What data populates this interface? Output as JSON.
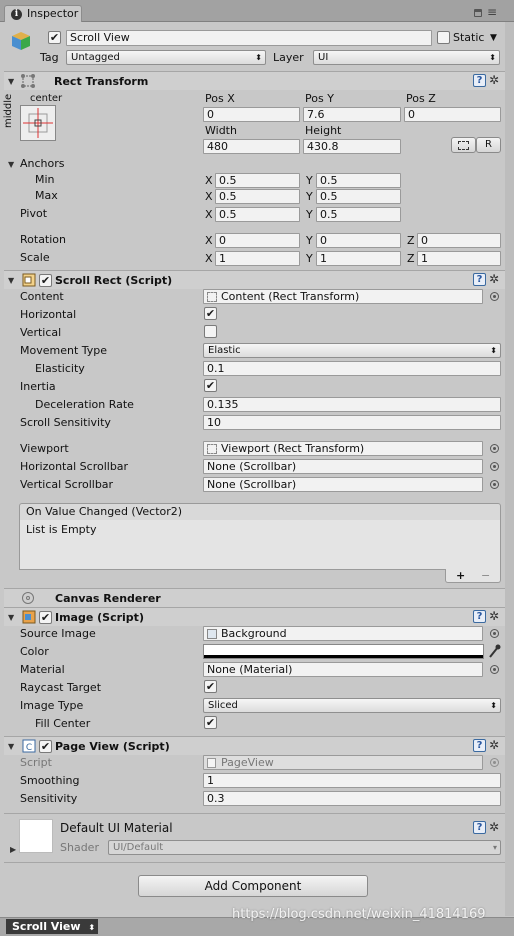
{
  "tab": {
    "title": "Inspector"
  },
  "object": {
    "name": "Scroll View",
    "static_label": "Static",
    "tag_label": "Tag",
    "tag_value": "Untagged",
    "layer_label": "Layer",
    "layer_value": "UI"
  },
  "rect_transform": {
    "title": "Rect Transform",
    "anchor_h": "center",
    "anchor_v": "middle",
    "pos_x_label": "Pos X",
    "pos_y_label": "Pos Y",
    "pos_z_label": "Pos Z",
    "pos_x": "0",
    "pos_y": "7.6",
    "pos_z": "0",
    "width_label": "Width",
    "height_label": "Height",
    "width": "480",
    "height": "430.8",
    "r_button": "R",
    "anchors_label": "Anchors",
    "min_label": "Min",
    "max_label": "Max",
    "pivot_label": "Pivot",
    "x": "X",
    "y": "Y",
    "z": "Z",
    "min_x": "0.5",
    "min_y": "0.5",
    "max_x": "0.5",
    "max_y": "0.5",
    "pivot_x": "0.5",
    "pivot_y": "0.5",
    "rotation_label": "Rotation",
    "rot_x": "0",
    "rot_y": "0",
    "rot_z": "0",
    "scale_label": "Scale",
    "scale_x": "1",
    "scale_y": "1",
    "scale_z": "1"
  },
  "scroll_rect": {
    "title": "Scroll Rect (Script)",
    "content_label": "Content",
    "content_value": "Content (Rect Transform)",
    "horizontal_label": "Horizontal",
    "vertical_label": "Vertical",
    "movement_label": "Movement Type",
    "movement_value": "Elastic",
    "elasticity_label": "Elasticity",
    "elasticity_value": "0.1",
    "inertia_label": "Inertia",
    "decel_label": "Deceleration Rate",
    "decel_value": "0.135",
    "sensitivity_label": "Scroll Sensitivity",
    "sensitivity_value": "10",
    "viewport_label": "Viewport",
    "viewport_value": "Viewport (Rect Transform)",
    "hscroll_label": "Horizontal Scrollbar",
    "hscroll_value": "None (Scrollbar)",
    "vscroll_label": "Vertical Scrollbar",
    "vscroll_value": "None (Scrollbar)",
    "event_title": "On Value Changed (Vector2)",
    "event_empty": "List is Empty",
    "plus": "+",
    "minus": "−"
  },
  "canvas_renderer": {
    "title": "Canvas Renderer"
  },
  "image": {
    "title": "Image (Script)",
    "source_label": "Source Image",
    "source_value": "Background",
    "color_label": "Color",
    "material_label": "Material",
    "material_value": "None (Material)",
    "raycast_label": "Raycast Target",
    "type_label": "Image Type",
    "type_value": "Sliced",
    "fill_label": "Fill Center"
  },
  "page_view": {
    "title": "Page View (Script)",
    "script_label": "Script",
    "script_value": "PageView",
    "smoothing_label": "Smoothing",
    "smoothing_value": "1",
    "sensitivity_label": "Sensitivity",
    "sensitivity_value": "0.3"
  },
  "material": {
    "title": "Default UI Material",
    "shader_label": "Shader",
    "shader_value": "UI/Default"
  },
  "add_component": "Add Component",
  "status": {
    "tab": "Scroll View"
  },
  "watermark": "https://blog.csdn.net/weixin_41814169"
}
